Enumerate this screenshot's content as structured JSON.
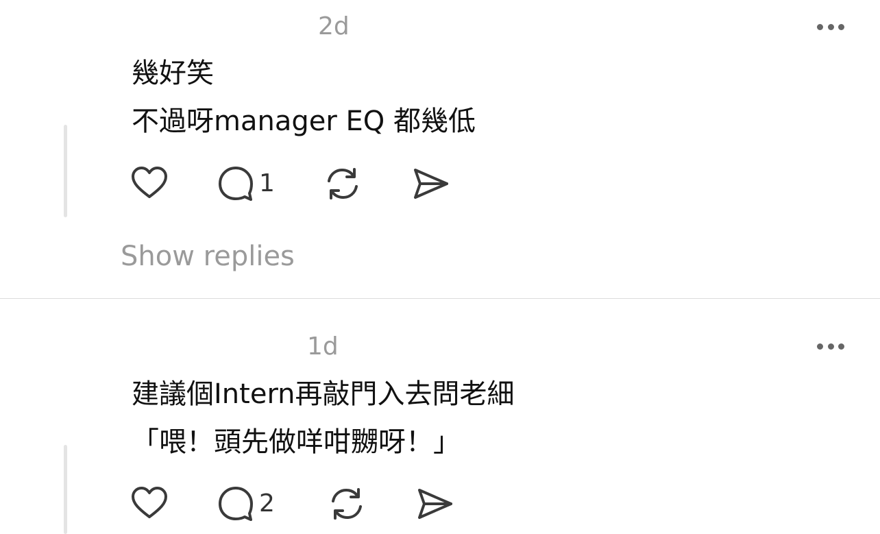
{
  "posts": [
    {
      "timestamp": "2d",
      "lines": [
        "幾好笑",
        "不過呀manager EQ 都幾低"
      ],
      "like_count": "",
      "reply_count": "1",
      "show_replies_label": "Show replies"
    },
    {
      "timestamp": "1d",
      "lines": [
        "建議個Intern再敲門入去問老細",
        "「喂！頭先做咩咁嬲呀！」"
      ],
      "like_count": "",
      "reply_count": "2"
    }
  ],
  "icons": {
    "like": "heart-icon",
    "reply": "speech-bubble-icon",
    "repost": "repost-icon",
    "share": "send-icon",
    "more": "more-horizontal-icon"
  },
  "colors": {
    "text": "#111111",
    "muted": "#9a9a9a",
    "icon": "#3a3a3a",
    "thread_line": "#e4e4e4",
    "divider": "#dcdcdc"
  }
}
